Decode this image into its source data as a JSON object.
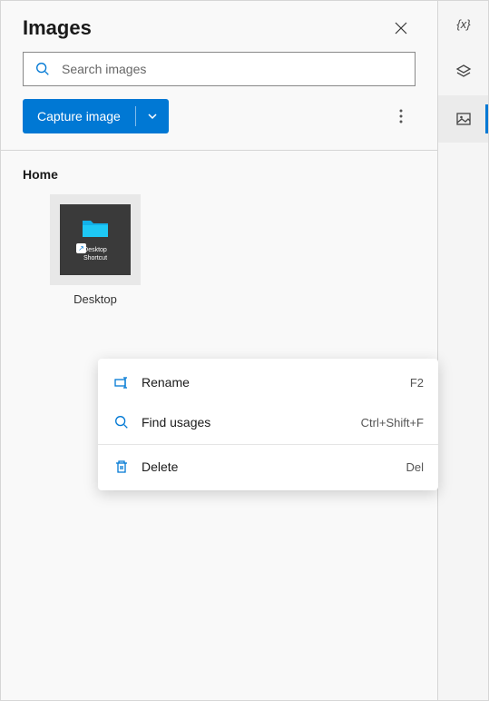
{
  "header": {
    "title": "Images"
  },
  "search": {
    "placeholder": "Search images"
  },
  "toolbar": {
    "capture_label": "Capture image"
  },
  "section": {
    "title": "Home"
  },
  "thumbnail": {
    "name": "Desktop",
    "inner_label": "Desktop\nShortcut"
  },
  "context_menu": {
    "items": [
      {
        "label": "Rename",
        "shortcut": "F2",
        "icon": "rename"
      },
      {
        "label": "Find usages",
        "shortcut": "Ctrl+Shift+F",
        "icon": "search"
      },
      {
        "label": "Delete",
        "shortcut": "Del",
        "icon": "delete"
      }
    ]
  },
  "sidebar": {
    "items": [
      {
        "name": "variables",
        "active": false
      },
      {
        "name": "layers",
        "active": false
      },
      {
        "name": "images",
        "active": true
      }
    ]
  }
}
